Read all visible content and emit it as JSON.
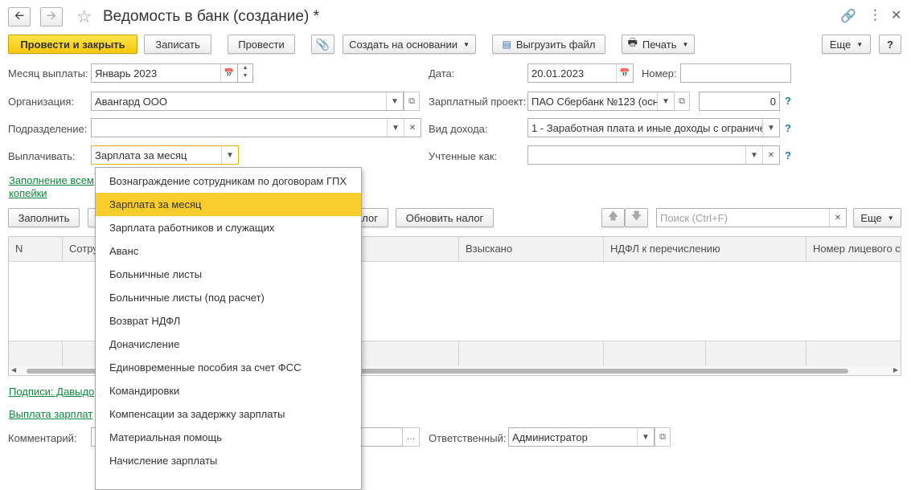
{
  "title": "Ведомость в банк (создание) *",
  "toolbar": {
    "post_close": "Провести и закрыть",
    "save": "Записать",
    "post": "Провести",
    "create_based": "Создать на основании",
    "export_file": "Выгрузить файл",
    "print": "Печать",
    "more": "Еще",
    "help": "?"
  },
  "form": {
    "month_label": "Месяц выплаты:",
    "month_value": "Январь 2023",
    "date_label": "Дата:",
    "date_value": "20.01.2023",
    "number_label": "Номер:",
    "number_value": "",
    "org_label": "Организация:",
    "org_value": "Авангард ООО",
    "salary_project_label": "Зарплатный проект:",
    "salary_project_value": "ПАО Сбербанк №123 (осн",
    "salary_project_number": "0",
    "dept_label": "Подразделение:",
    "dept_value": "",
    "income_label": "Вид дохода:",
    "income_value": "1 - Заработная плата и иные доходы с ограниче",
    "pay_label": "Выплачивать:",
    "pay_value": "Зарплата за месяц",
    "counted_label": "Учтенные как:",
    "counted_value": "",
    "comment_label": "Комментарий:",
    "responsible_label": "Ответственный:",
    "responsible_value": "Администратор"
  },
  "links": {
    "fill_all": "Заполнение всем",
    "kopecks": "копейки",
    "signatures": "Подписи: Давыдо",
    "salary_payment": "Выплата зарплат"
  },
  "table_toolbar": {
    "fill": "Заполнить",
    "tax_fragment": "алог",
    "update_tax": "Обновить налог",
    "search_placeholder": "Поиск (Ctrl+F)",
    "more": "Еще"
  },
  "table": {
    "columns": [
      "N",
      "Сотру",
      "Взыскано",
      "НДФЛ к перечислению",
      "Номер лицевого сч"
    ]
  },
  "dropdown": {
    "items": [
      "Вознаграждение сотрудникам по договорам ГПХ",
      "Зарплата за месяц",
      "Зарплата работников и служащих",
      "Аванс",
      "Больничные листы",
      "Больничные листы (под расчет)",
      "Возврат НДФЛ",
      "Доначисление",
      "Единовременные пособия за счет ФСС",
      "Командировки",
      "Компенсации за задержку зарплаты",
      "Материальная помощь",
      "Начисление зарплаты"
    ],
    "selected": "Зарплата за месяц"
  },
  "colors": {
    "primary": "#f5c80b",
    "selected_item": "#f8cc2a",
    "link": "#0c8a3a",
    "help": "#1a7fb8"
  }
}
